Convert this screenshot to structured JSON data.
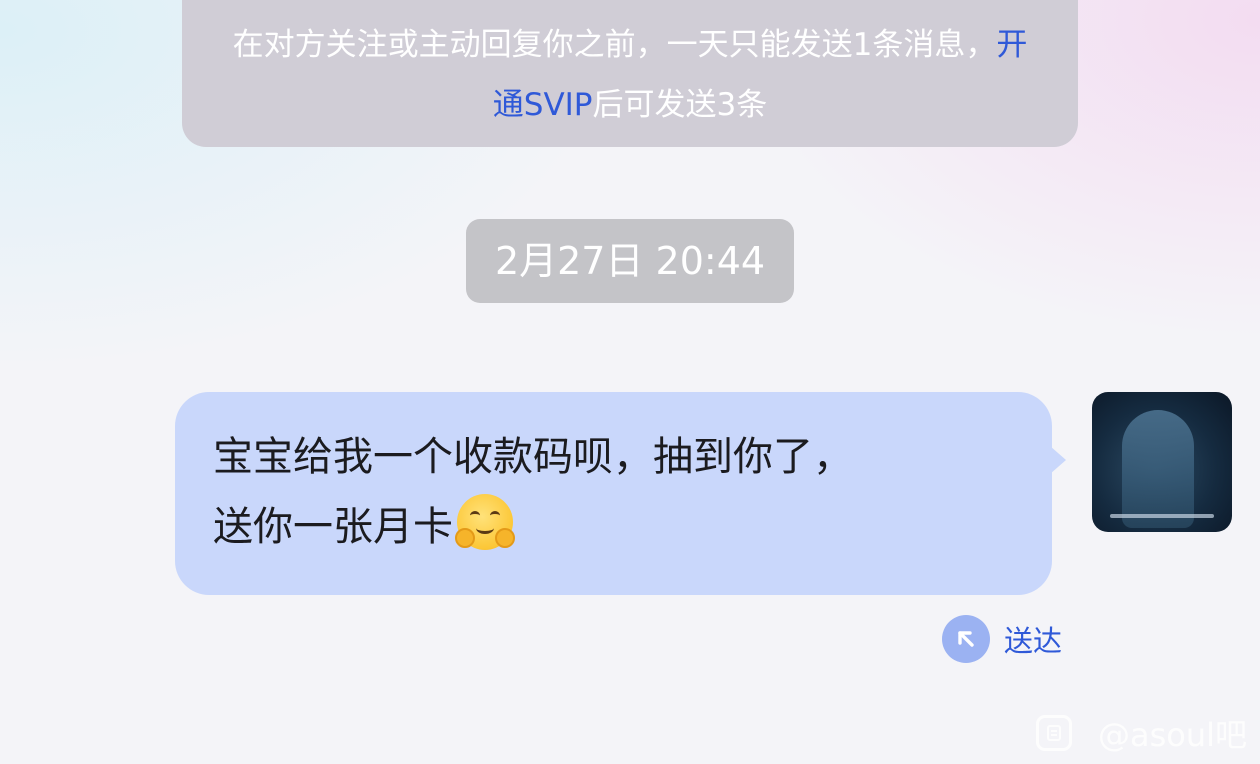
{
  "notice": {
    "text_before": "在对方关注或主动回复你之前，一天只能发送1条消息，",
    "link": "开通SVIP",
    "text_after": "后可发送3条"
  },
  "timestamp": "2月27日 20:44",
  "message": {
    "line1": "宝宝给我一个收款码呗，抽到你了，",
    "line2": "送你一张月卡",
    "emoji": "hugging-face-emoji"
  },
  "status": {
    "label": "送达",
    "icon": "arrow-up-left-icon"
  },
  "watermark": {
    "text": "@asoul吧",
    "icon": "tieba-logo-icon"
  },
  "colors": {
    "bubble": "#c9d7fb",
    "link": "#2f59d8",
    "notice_bg": "#d0cdd6",
    "timestamp_bg": "#c4c4c8",
    "status_icon_bg": "#9bb2f2"
  }
}
